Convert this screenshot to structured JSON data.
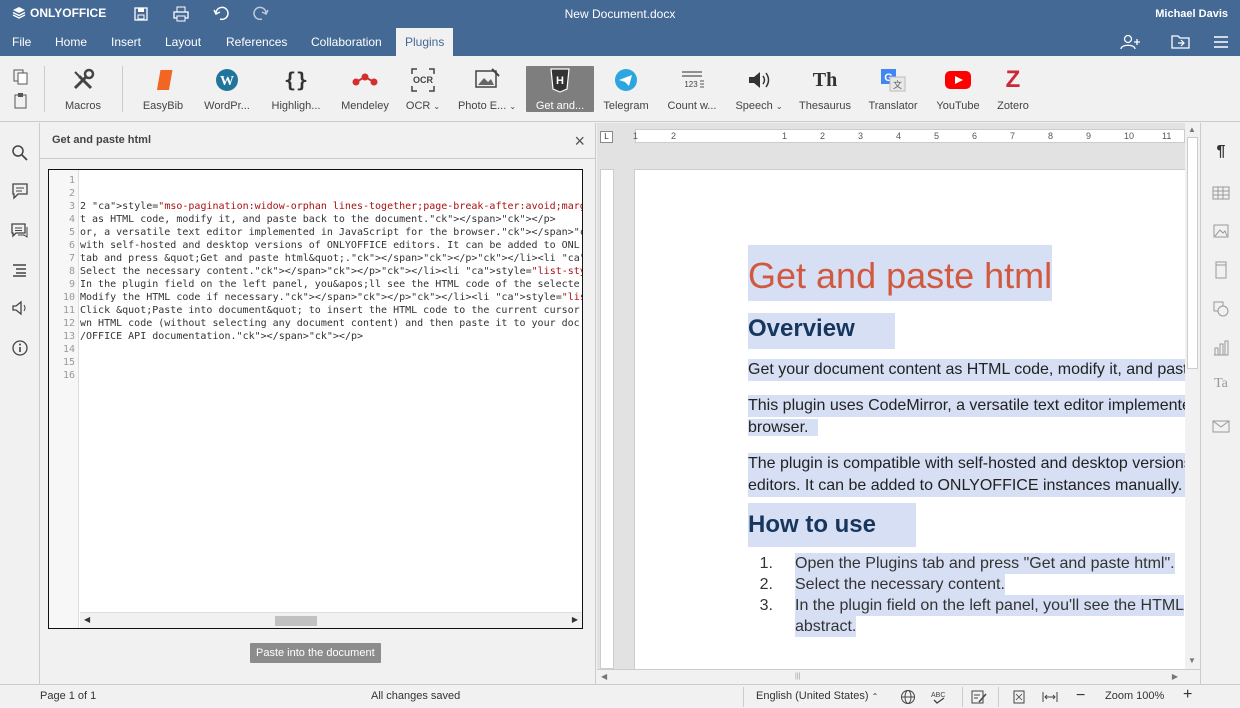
{
  "app": {
    "logo": "ONLYOFFICE",
    "doc_title": "New Document.docx",
    "user": "Michael Davis"
  },
  "tabs": [
    "File",
    "Home",
    "Insert",
    "Layout",
    "References",
    "Collaboration",
    "Plugins"
  ],
  "active_tab": "Plugins",
  "plugins": [
    {
      "label": "Macros",
      "icon": "macros-icon"
    },
    {
      "label": "EasyBib",
      "icon": "easybib-icon"
    },
    {
      "label": "WordPr...",
      "icon": "wordpress-icon"
    },
    {
      "label": "Highligh...",
      "icon": "highlight-code-icon"
    },
    {
      "label": "Mendeley",
      "icon": "mendeley-icon"
    },
    {
      "label": "OCR",
      "icon": "ocr-icon"
    },
    {
      "label": "Photo E...",
      "icon": "photo-editor-icon"
    },
    {
      "label": "Get and...",
      "icon": "html-icon"
    },
    {
      "label": "Telegram",
      "icon": "telegram-icon"
    },
    {
      "label": "Count w...",
      "icon": "count-words-icon"
    },
    {
      "label": "Speech",
      "icon": "speech-icon"
    },
    {
      "label": "Thesaurus",
      "icon": "thesaurus-icon"
    },
    {
      "label": "Translator",
      "icon": "translator-icon"
    },
    {
      "label": "YouTube",
      "icon": "youtube-icon"
    },
    {
      "label": "Zotero",
      "icon": "zotero-icon"
    }
  ],
  "panel": {
    "title": "Get and paste html",
    "paste_button": "Paste into the document"
  },
  "code_lines": [
    "",
    "",
    "2 style=\"mso-pagination:widow-orphan lines-together;page-break-after:avoid;margin-to",
    "t as HTML code, modify it, and paste back to the document.</span></p>",
    "or, a versatile text editor implemented in JavaScript for the browser.</span></p>",
    "with self-hosted and desktop versions of ONLYOFFICE editors. It can be added to ONL",
    "tab and press &quot;Get and paste html&quot;.</span></p></li><li style=\"list-style-",
    "Select the necessary content.</span></p></li><li style=\"list-style-type: decimal\"",
    "In the plugin field on the left panel, you&apos;ll see the HTML code of the selecte",
    "Modify the HTML code if necessary.</span></p></li><li style=\"list-style-type: decim",
    "Click &quot;Paste into document&quot; to insert the HTML code to the current cursor",
    "wn HTML code (without selecting any document content) and then paste it to your doc",
    "/OFFICE API documentation.</span></p>",
    "",
    "",
    ""
  ],
  "line_numbers": [
    "1",
    "2",
    "3",
    "4",
    "5",
    "6",
    "7",
    "8",
    "9",
    "10",
    "11",
    "12",
    "13",
    "14",
    "15",
    "16"
  ],
  "ruler_labels": [
    "2",
    "1",
    "1",
    "2",
    "3",
    "4",
    "5",
    "6",
    "7",
    "8",
    "9",
    "10",
    "11"
  ],
  "document": {
    "title": "Get and paste html",
    "h_overview": "Overview",
    "p1": "Get your document content as HTML code, modify it, and past",
    "p2a": "This plugin uses CodeMirror, a versatile text editor implemente",
    "p2b": "browser.",
    "p3a": "The plugin is compatible with self-hosted and desktop versions",
    "p3b": "editors. It can be added to ONLYOFFICE instances manually.",
    "h_howto": "How to use",
    "list": [
      {
        "n": "1.",
        "text": "Open the Plugins tab and press \"Get and paste html\"."
      },
      {
        "n": "2.",
        "text": "Select the necessary content."
      },
      {
        "n": "3.",
        "text": "In the plugin field on the left panel, you'll see the HTML"
      },
      {
        "n": "",
        "text": "abstract."
      }
    ]
  },
  "status": {
    "page": "Page 1 of 1",
    "saved": "All changes saved",
    "language": "English (United States)",
    "zoom": "Zoom 100%"
  },
  "colors": {
    "brand": "#446995",
    "heading": "#d0593f",
    "selection": "#d6dff3"
  }
}
